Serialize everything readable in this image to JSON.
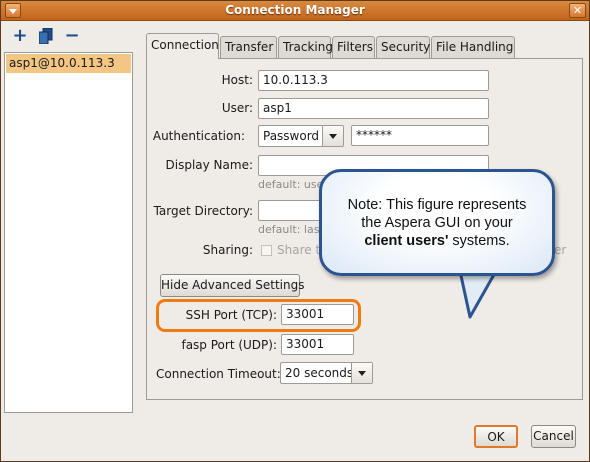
{
  "window": {
    "title": "Connection Manager"
  },
  "toolbar": {
    "icons": [
      "add-icon",
      "duplicate-icon",
      "remove-icon"
    ]
  },
  "sidebar": {
    "items": [
      {
        "label": "asp1@10.0.113.3",
        "selected": true
      }
    ]
  },
  "tabs": [
    {
      "label": "Connection",
      "active": true
    },
    {
      "label": "Transfer"
    },
    {
      "label": "Tracking"
    },
    {
      "label": "Filters"
    },
    {
      "label": "Security"
    },
    {
      "label": "File Handling"
    }
  ],
  "form": {
    "host_label": "Host:",
    "host_value": "10.0.113.3",
    "user_label": "User:",
    "user_value": "asp1",
    "auth_label": "Authentication:",
    "auth_value": "Password",
    "password_value": "******",
    "display_name_label": "Display Name:",
    "display_name_value": "",
    "display_name_hint": "default: use",
    "target_dir_label": "Target Directory:",
    "target_dir_value": "",
    "target_dir_hint": "default: last",
    "sharing_label": "Sharing:",
    "sharing_text_left": "Share th",
    "sharing_text_right": "er",
    "advanced_button": "Hide Advanced Settings",
    "ssh_port_label": "SSH Port (TCP):",
    "ssh_port_value": "33001",
    "fasp_port_label": "fasp Port (UDP):",
    "fasp_port_value": "33001",
    "timeout_label": "Connection Timeout:",
    "timeout_value": "20 seconds"
  },
  "callout": {
    "line1": "Note: This figure represents",
    "line2": "the Aspera GUI on your",
    "line3_bold": "client users'",
    "line3_rest": " systems."
  },
  "buttons": {
    "ok": "OK",
    "cancel": "Cancel"
  },
  "colors": {
    "titlebar": "#c2641c",
    "selection": "#f4c684",
    "highlight": "#f07b12",
    "callout_border": "#2a5590"
  }
}
